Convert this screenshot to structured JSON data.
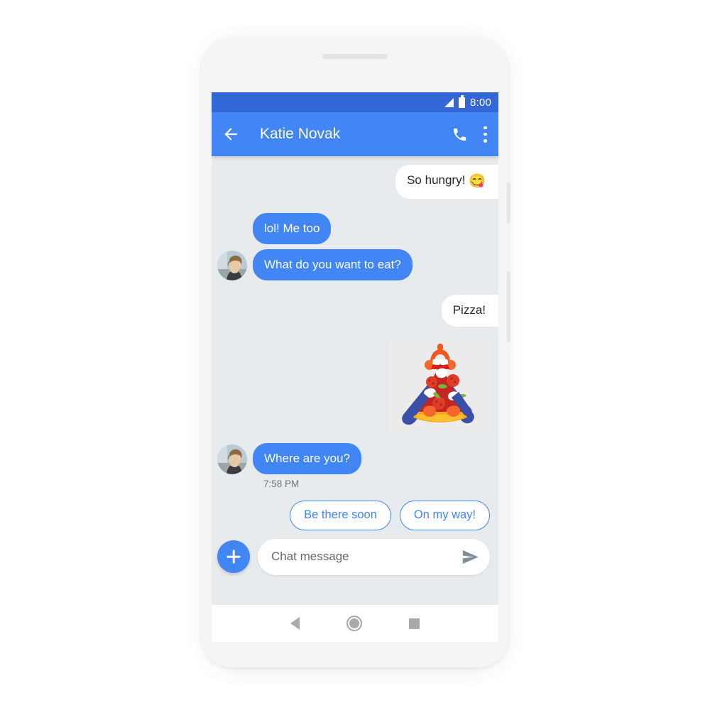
{
  "device": {
    "frame_color": "#f5f5f5",
    "speaker_grille": "speaker-grille"
  },
  "status_bar": {
    "time": "8:00",
    "background": "#3367d6",
    "signal_icon": "signal-icon",
    "battery_icon": "battery-icon"
  },
  "app_bar": {
    "background": "#4285f4",
    "title": "Katie Novak",
    "back_icon": "back-arrow-icon",
    "call_icon": "phone-call-icon",
    "overflow_icon": "more-vert-icon"
  },
  "conversation": {
    "background": "#e8ebed",
    "incoming_bubble_color": "#4285f4",
    "outgoing_bubble_color": "#ffffff",
    "messages": [
      {
        "id": "m1",
        "direction": "out",
        "text": "So hungry!",
        "emoji": "😋"
      },
      {
        "id": "m2",
        "direction": "in",
        "text": "lol! Me too"
      },
      {
        "id": "m3",
        "direction": "in",
        "text": "What do you want to eat?"
      },
      {
        "id": "m4",
        "direction": "out",
        "text": "Pizza!"
      },
      {
        "id": "m5",
        "direction": "out",
        "type": "sticker",
        "sticker_name": "pizza-hug-sticker"
      },
      {
        "id": "m6",
        "direction": "in",
        "text": "Where are you?"
      }
    ],
    "timestamp": "7:58 PM",
    "avatar_name": "katie-novak-avatar"
  },
  "suggestions": {
    "border_color": "#4285f4",
    "chips": [
      {
        "label": "Be there soon"
      },
      {
        "label": "On my way!"
      }
    ]
  },
  "compose": {
    "add_button_icon": "plus-icon",
    "placeholder": "Chat message",
    "value": "",
    "send_icon": "send-icon"
  },
  "nav_bar": {
    "back_icon": "nav-back-icon",
    "home_icon": "nav-home-icon",
    "recents_icon": "nav-recents-icon"
  }
}
